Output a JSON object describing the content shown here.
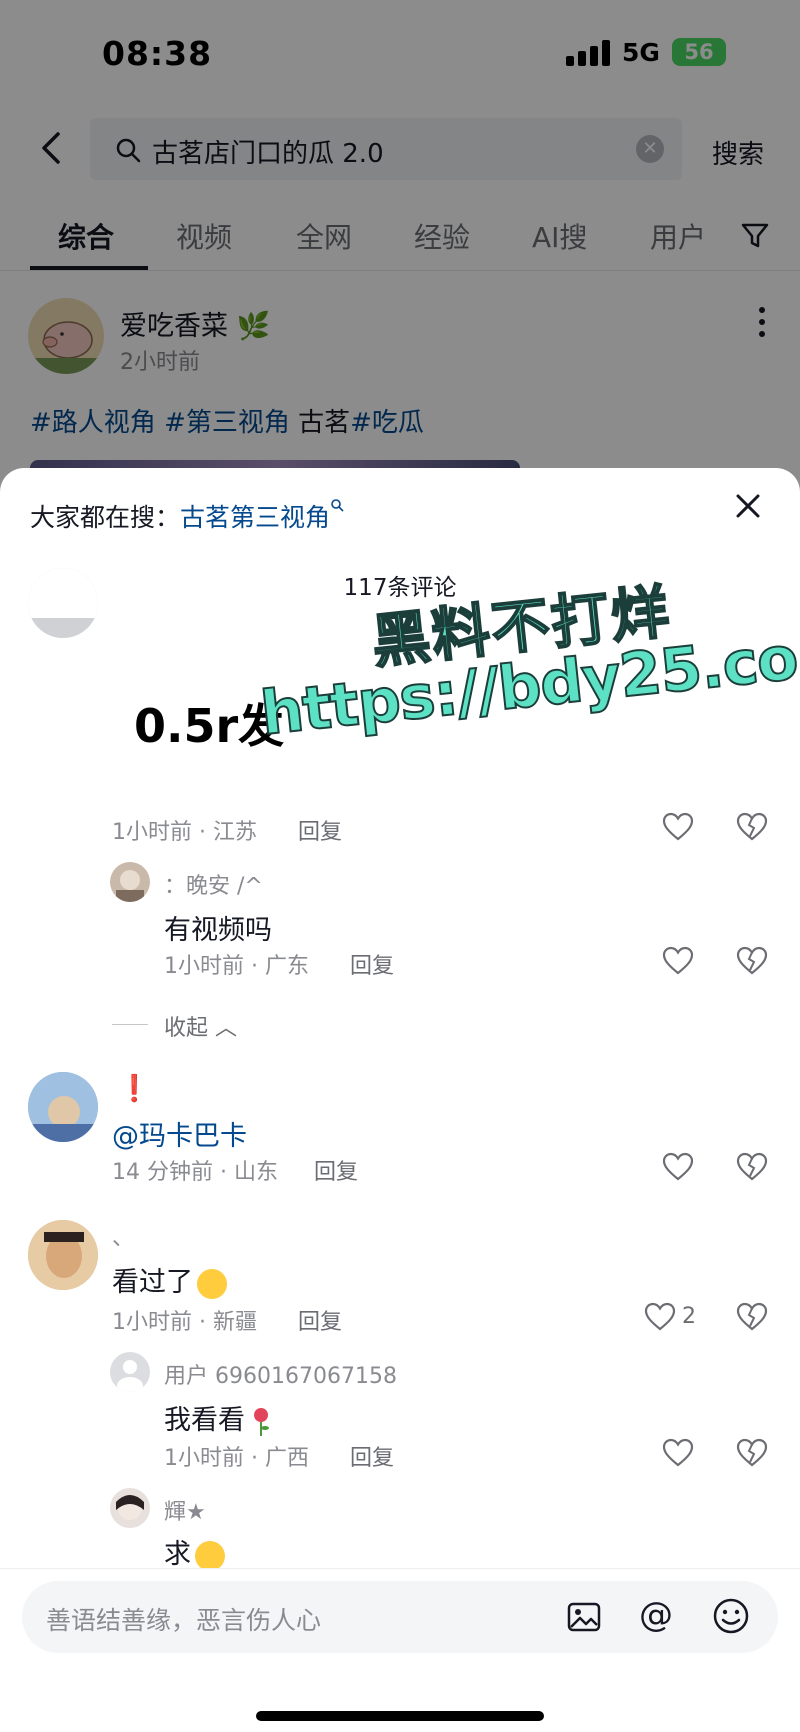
{
  "status_bar": {
    "time": "08:38",
    "network": "5G",
    "battery": "56"
  },
  "search": {
    "query": "古茗店门口的瓜 2.0",
    "button": "搜索"
  },
  "tabs": [
    "综合",
    "视频",
    "全网",
    "经验",
    "AI搜",
    "用户"
  ],
  "post": {
    "author": "爱吃香菜",
    "time": "2小时前",
    "tags": [
      "#路人视角",
      "#第三视角",
      "古茗",
      "#吃瓜"
    ]
  },
  "sheet": {
    "hot_search_label": "大家都在搜：",
    "hot_search_link": "古茗第三视角",
    "comment_count": "117条评论",
    "first_comment_text": "0.5r发",
    "first_comment_meta": "1小时前 · 江苏",
    "reply_label": "回复",
    "collapse_label": "收起"
  },
  "comments": [
    {
      "username": "：晚安 /^",
      "text": "有视频吗",
      "meta": "1小时前 · 广东"
    },
    {
      "username": "❗",
      "text": "@玛卡巴卡",
      "meta": "14 分钟前 · 山东"
    },
    {
      "username": "、",
      "text": "看过了",
      "meta": "1小时前 · 新疆",
      "likes": "2"
    },
    {
      "username": "用户 6960167067158",
      "text": "我看看",
      "meta": "1小时前 · 广西"
    },
    {
      "username": "輝★",
      "text": "求"
    }
  ],
  "watermark": {
    "line1": "黑料不打烊",
    "line2": "https://bdy25.co"
  },
  "input": {
    "placeholder": "善语结善缘，恶言伤人心"
  },
  "colors": {
    "link": "#04498d",
    "watermark": "#5ce1c4",
    "battery": "#4cd964"
  }
}
